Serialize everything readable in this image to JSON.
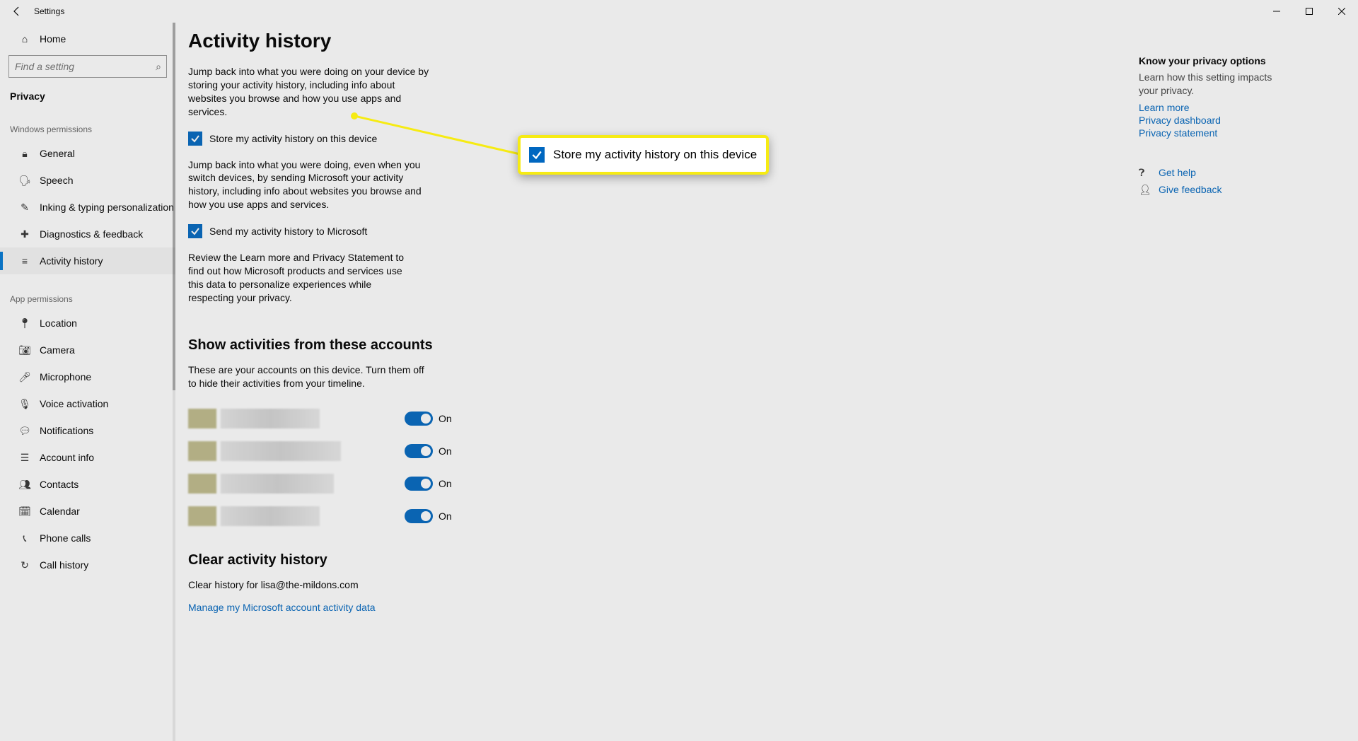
{
  "window": {
    "title": "Settings"
  },
  "sidebar": {
    "home": "Home",
    "search_placeholder": "Find a setting",
    "section": "Privacy",
    "group1": "Windows permissions",
    "group2": "App permissions",
    "items1": [
      {
        "label": "General",
        "icon": "lock-icon"
      },
      {
        "label": "Speech",
        "icon": "speech-icon"
      },
      {
        "label": "Inking & typing personalization",
        "icon": "ink-icon"
      },
      {
        "label": "Diagnostics & feedback",
        "icon": "diag-icon"
      },
      {
        "label": "Activity history",
        "icon": "history-icon"
      }
    ],
    "items2": [
      {
        "label": "Location",
        "icon": "location-icon"
      },
      {
        "label": "Camera",
        "icon": "camera-icon"
      },
      {
        "label": "Microphone",
        "icon": "mic-icon"
      },
      {
        "label": "Voice activation",
        "icon": "voice-icon"
      },
      {
        "label": "Notifications",
        "icon": "notif-icon"
      },
      {
        "label": "Account info",
        "icon": "account-icon"
      },
      {
        "label": "Contacts",
        "icon": "contacts-icon"
      },
      {
        "label": "Calendar",
        "icon": "calendar-icon"
      },
      {
        "label": "Phone calls",
        "icon": "phone-icon"
      },
      {
        "label": "Call history",
        "icon": "callhist-icon"
      }
    ]
  },
  "main": {
    "title": "Activity history",
    "desc1": "Jump back into what you were doing on your device by storing your activity history, including info about websites you browse and how you use apps and services.",
    "chk1": "Store my activity history on this device",
    "desc2": "Jump back into what you were doing, even when you switch devices, by sending Microsoft your activity history, including info about websites you browse and how you use apps and services.",
    "chk2": "Send my activity history to Microsoft",
    "desc3": "Review the Learn more and Privacy Statement to find out how Microsoft products and services use this data to personalize experiences while respecting your privacy.",
    "sub1": "Show activities from these accounts",
    "sub1_desc": "These are your accounts on this device. Turn them off to hide their activities from your timeline.",
    "toggle_on": "On",
    "sub2": "Clear activity history",
    "clear_text": "Clear history for lisa@the-mildons.com",
    "manage_link": "Manage my Microsoft account activity data"
  },
  "aside": {
    "heading": "Know your privacy options",
    "desc": "Learn how this setting impacts your privacy.",
    "links": [
      "Learn more",
      "Privacy dashboard",
      "Privacy statement"
    ],
    "help": "Get help",
    "feedback": "Give feedback"
  },
  "callout": {
    "text": "Store my activity history on this device"
  }
}
